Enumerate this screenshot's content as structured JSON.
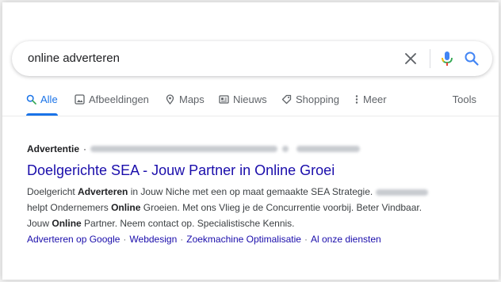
{
  "search": {
    "query": "online adverteren"
  },
  "tabs": [
    {
      "label": "Alle",
      "icon": "search-icon",
      "active": true
    },
    {
      "label": "Afbeeldingen",
      "icon": "image-icon"
    },
    {
      "label": "Maps",
      "icon": "map-pin-icon"
    },
    {
      "label": "Nieuws",
      "icon": "newspaper-icon"
    },
    {
      "label": "Shopping",
      "icon": "tag-icon"
    },
    {
      "label": "Meer",
      "icon": "more-vert-icon"
    }
  ],
  "tools_label": "Tools",
  "result": {
    "ad_label": "Advertentie",
    "ad_separator": "·",
    "title": "Doelgerichte SEA - Jouw Partner in Online Groei",
    "snippet": {
      "l1_a": "Doelgericht ",
      "l1_b": "Adverteren",
      "l1_c": " in Jouw Niche met een op maat gemaakte SEA Strategie.",
      "l2_a": "helpt Ondernemers ",
      "l2_b": "Online",
      "l2_c": " Groeien. Met ons Vlieg je de Concurrentie voorbij. Beter Vindbaar.",
      "l3_a": "Jouw ",
      "l3_b": "Online",
      "l3_c": " Partner. Neem contact op. Specialistische Kennis."
    },
    "sitelinks": [
      "Adverteren op Google",
      "Webdesign",
      "Zoekmachine Optimalisatie",
      "Al onze diensten"
    ],
    "sitelink_separator": "·"
  },
  "colors": {
    "link": "#1a0dab",
    "accent": "#1a73e8",
    "muted": "#5f6368"
  }
}
